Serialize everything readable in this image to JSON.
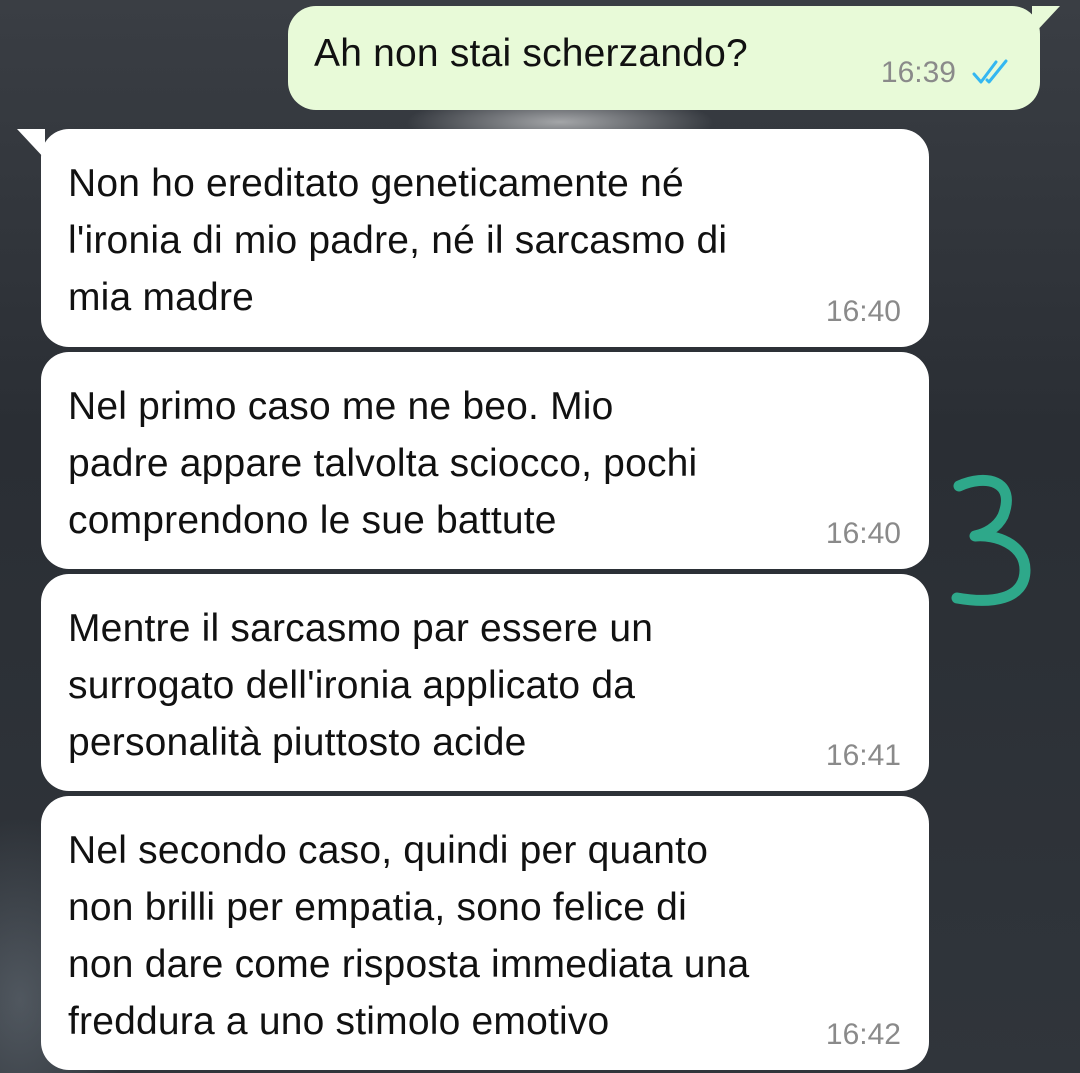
{
  "conversation": {
    "outgoing": {
      "text": "Ah non stai scherzando?",
      "time": "16:39",
      "status_icon": "double-check-read-icon",
      "status_color": "#34b7f1"
    },
    "incoming": [
      {
        "text": "Non ho ereditato geneticamente né\nl'ironia di mio padre, né il sarcasmo di\nmia madre",
        "time": "16:40"
      },
      {
        "text": "Nel primo caso me ne beo. Mio\npadre appare talvolta sciocco, pochi\ncomprendono le sue battute",
        "time": "16:40"
      },
      {
        "text": "Mentre il sarcasmo par essere un\nsurrogato dell'ironia applicato da\npersonalità piuttosto acide",
        "time": "16:41"
      },
      {
        "text": "Nel secondo caso, quindi per quanto\nnon brilli per empatia, sono felice di\nnon dare come risposta immediata una\nfreddura a uno stimolo emotivo",
        "time": "16:42"
      }
    ]
  },
  "annotation": {
    "text": "3",
    "color": "#2ea88a"
  },
  "colors": {
    "outgoing_bubble": "#e8fad8",
    "incoming_bubble": "#ffffff",
    "timestamp": "#8a8a8a"
  }
}
